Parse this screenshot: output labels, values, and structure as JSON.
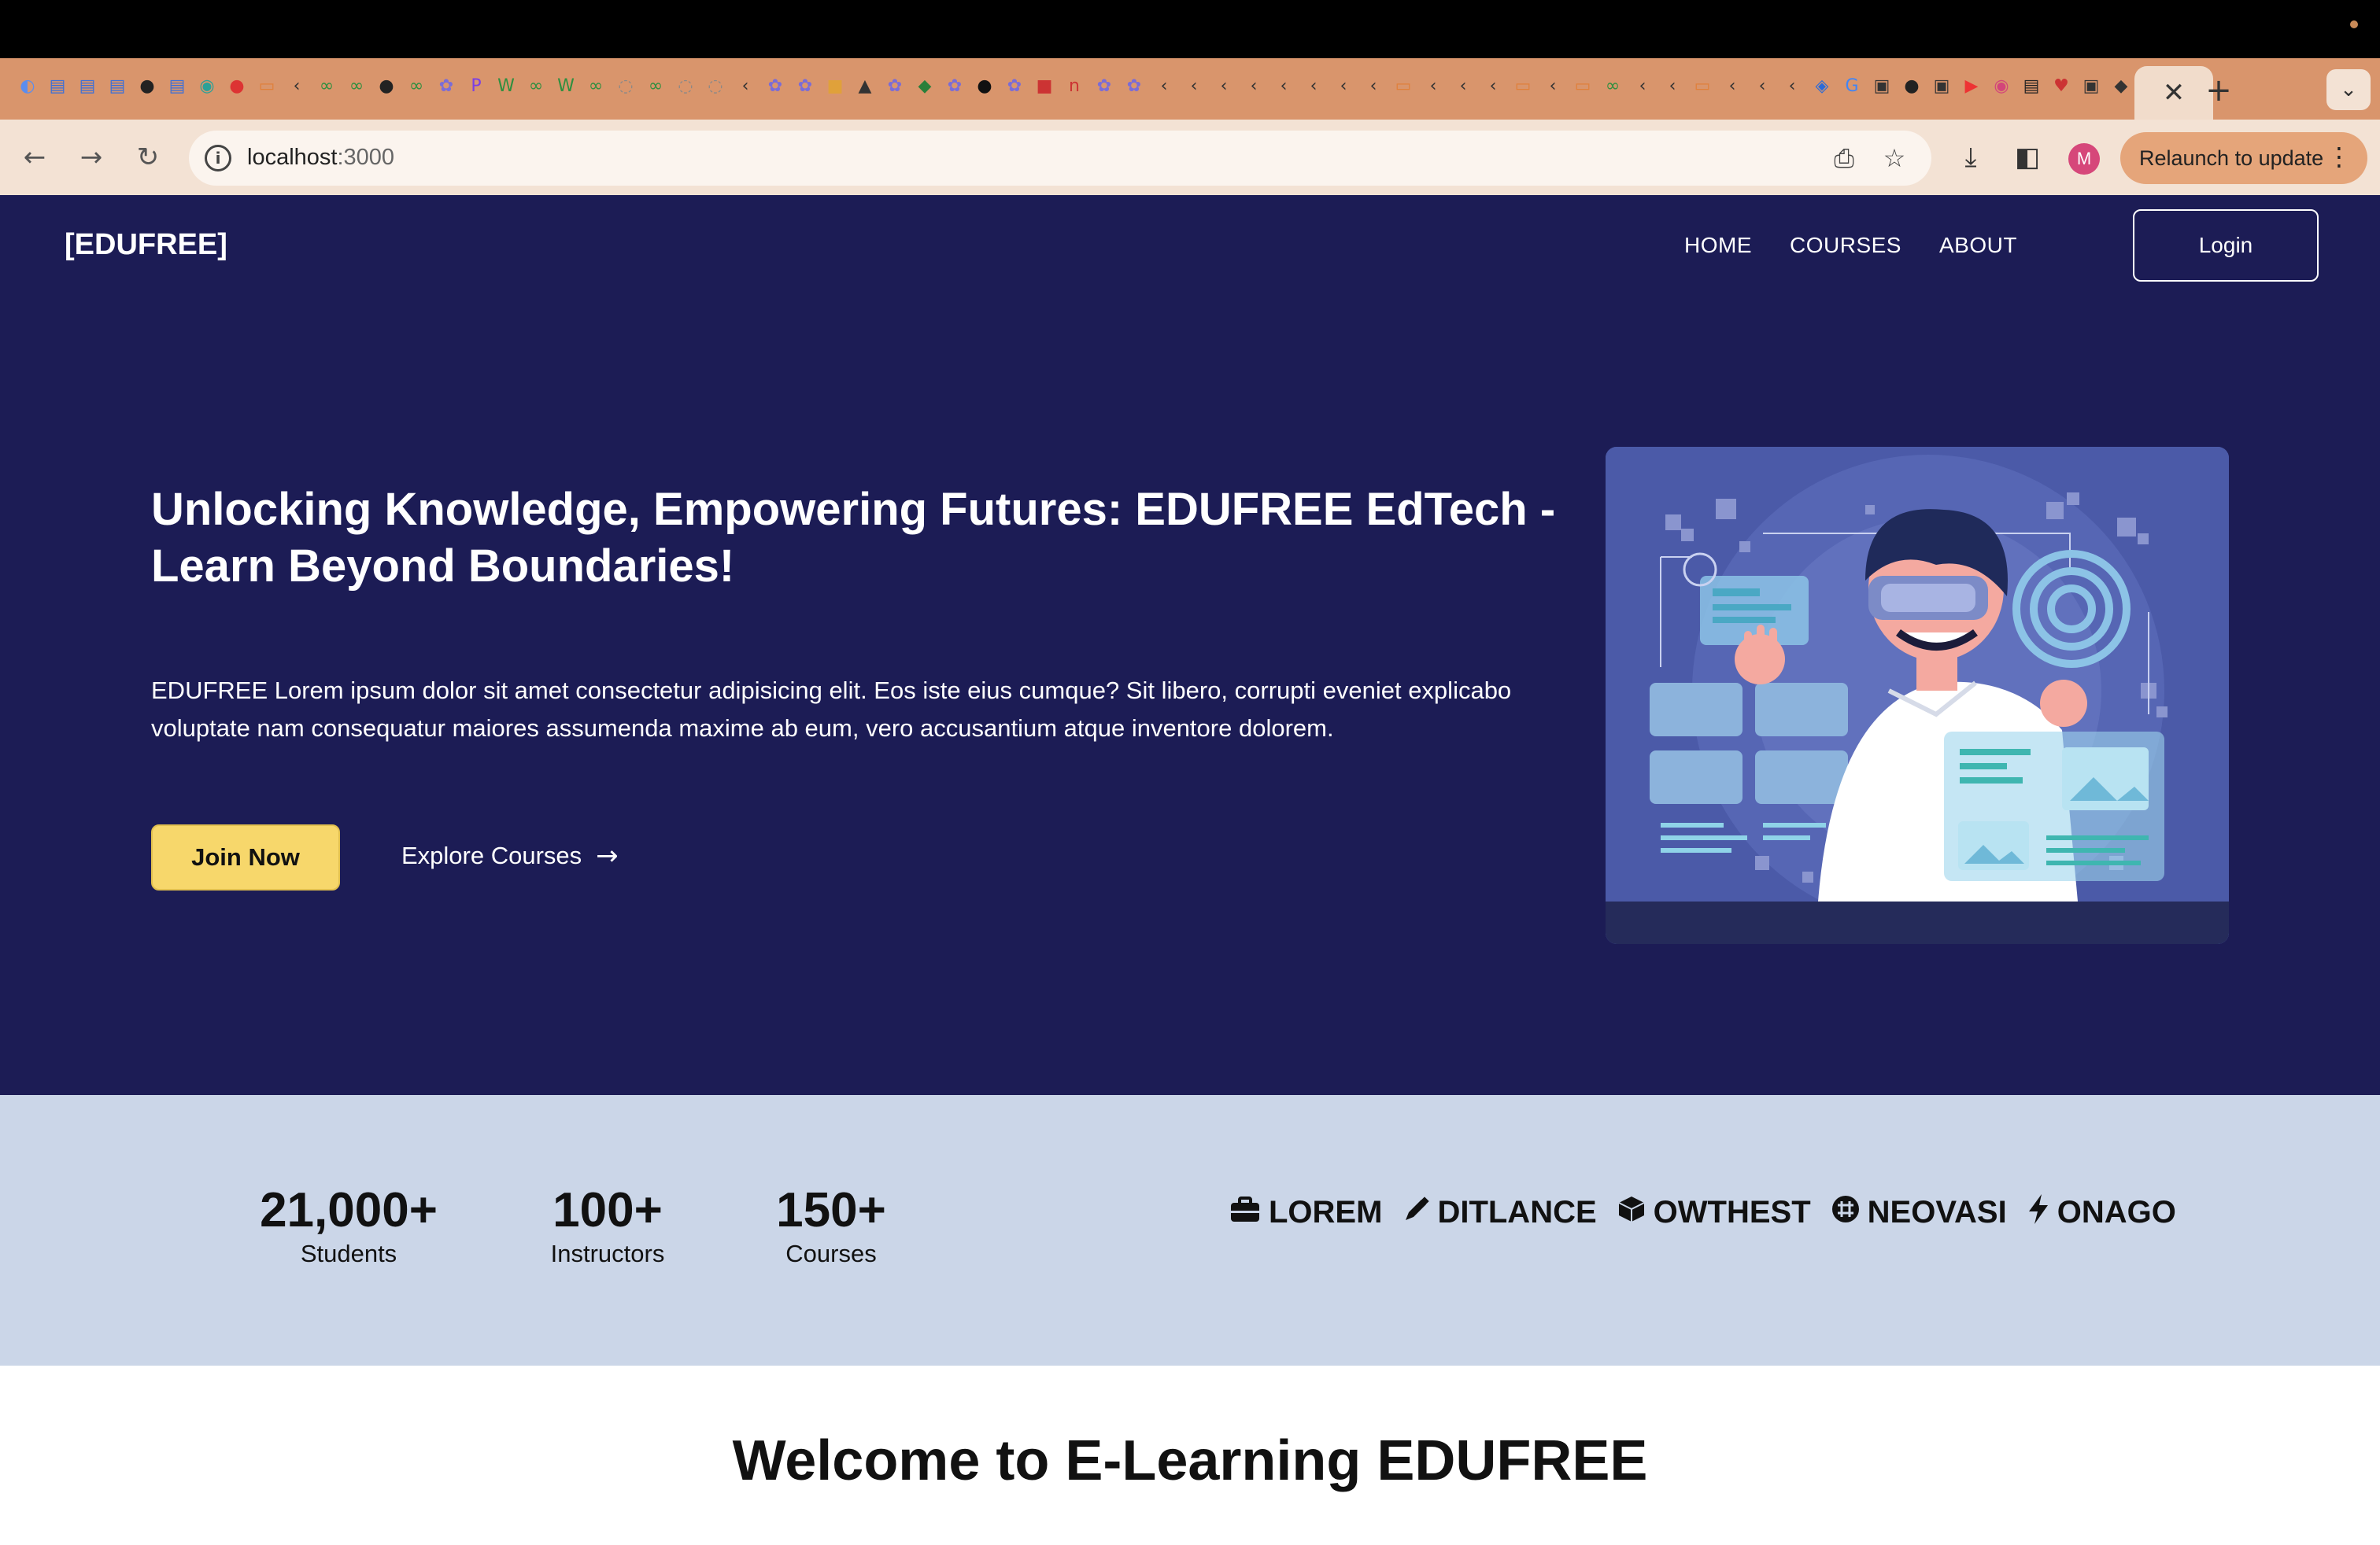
{
  "browser": {
    "tab_favicons": [
      "◐",
      "▤",
      "▤",
      "▤",
      "●",
      "▤",
      "◉",
      "●",
      "▭",
      "‹",
      "∞",
      "∞",
      "●",
      "∞",
      "✿",
      "P",
      "W",
      "∞",
      "W",
      "∞",
      "◌",
      "∞",
      "◌",
      "◌",
      "‹",
      "✿",
      "✿",
      "■",
      "▲",
      "✿",
      "◆",
      "✿",
      "●",
      "✿",
      "■",
      "n",
      "✿",
      "✿",
      "‹",
      "‹",
      "‹",
      "‹",
      "‹",
      "‹",
      "‹",
      "‹",
      "▭",
      "‹",
      "‹",
      "‹",
      "▭",
      "‹",
      "▭",
      "∞",
      "‹",
      "‹",
      "▭",
      "‹",
      "‹",
      "‹",
      "◈",
      "G",
      "▣",
      "●",
      "▣",
      "▶",
      "◉",
      "▤",
      "♥",
      "▣",
      "◆",
      "▣",
      "◎"
    ],
    "active_tab_close": "✕",
    "new_tab": "+",
    "tab_list": "⌄",
    "back": "←",
    "forward": "→",
    "reload": "↻",
    "url_host": "localhost",
    "url_port": ":3000",
    "install_icon": "⎙",
    "bookmark_icon": "☆",
    "download_icon": "⤓",
    "sidepanel_icon": "◧",
    "profile_initial": "M",
    "relaunch_label": "Relaunch to update",
    "menu_dots": "⋮"
  },
  "site": {
    "brand": "[EDUFREE]",
    "nav": [
      "HOME",
      "COURSES",
      "ABOUT"
    ],
    "login": "Login",
    "hero_title": "Unlocking Knowledge, Empowering Futures: EDUFREE EdTech - Learn Beyond Boundaries!",
    "hero_text": "EDUFREE Lorem ipsum dolor sit amet consectetur adipisicing elit. Eos iste eius cumque? Sit libero, corrupti eveniet explicabo voluptate nam consequatur maiores assumenda maxime ab eum, vero accusantium atque inventore dolorem.",
    "join": "Join Now",
    "explore": "Explore Courses",
    "explore_arrow": "→",
    "stats": [
      {
        "num": "21,000+",
        "label": "Students"
      },
      {
        "num": "100+",
        "label": "Instructors"
      },
      {
        "num": "150+",
        "label": "Courses"
      }
    ],
    "partners": [
      {
        "name": "LOREM",
        "icon": "briefcase-icon"
      },
      {
        "name": "DITLANCE",
        "icon": "pen-icon"
      },
      {
        "name": "OWTHEST",
        "icon": "cube-icon"
      },
      {
        "name": "NEOVASI",
        "icon": "slack-icon"
      },
      {
        "name": "ONAGO",
        "icon": "bolt-icon"
      }
    ],
    "welcome": "Welcome to E-Learning EDUFREE"
  },
  "colors": {
    "hero_bg": "#1c1c55",
    "stats_bg": "#cbd6e8",
    "join_bg": "#f7d76b",
    "tab_strip": "#d9956c",
    "toolbar": "#f3e2d4"
  }
}
